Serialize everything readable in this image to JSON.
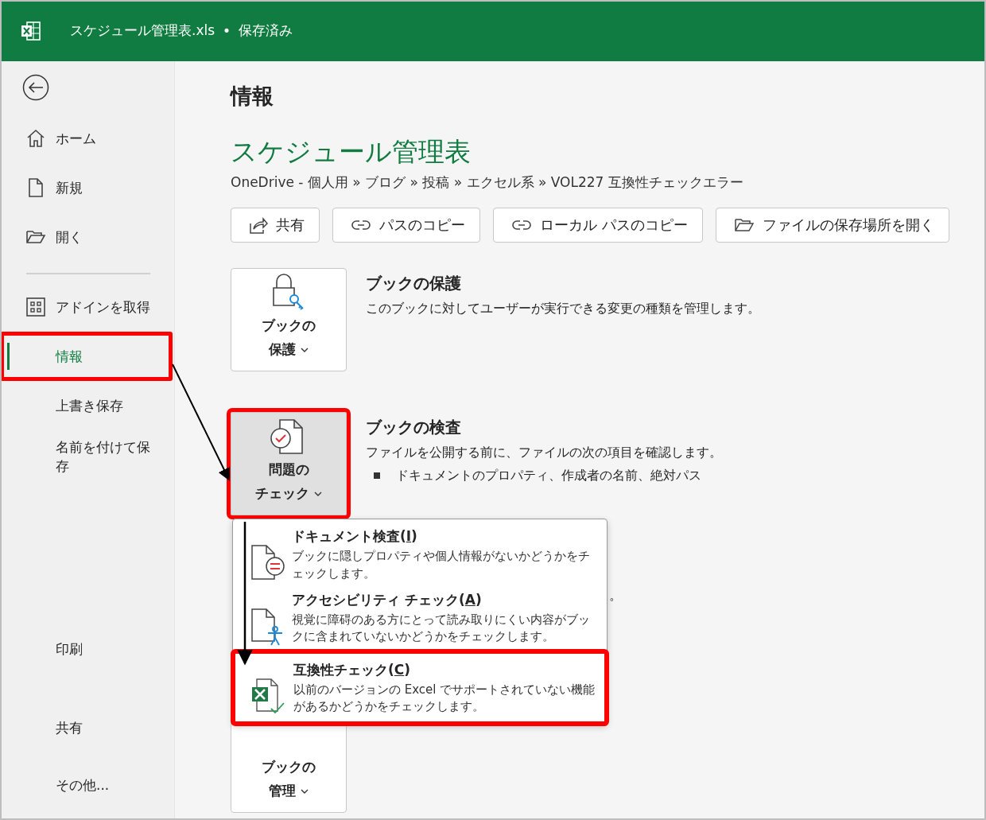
{
  "title_bar": {
    "file_name": "スケジュール管理表.xls",
    "separator": "•",
    "save_status": "保存済み"
  },
  "sidebar": {
    "top_items": [
      {
        "label": "ホーム",
        "kind": "home"
      },
      {
        "label": "新規",
        "kind": "new"
      },
      {
        "label": "開く",
        "kind": "open"
      }
    ],
    "items": [
      {
        "label": "アドインを取得",
        "kind": "addin",
        "selected": false,
        "highlighted": false
      },
      {
        "label": "情報",
        "kind": "plain",
        "selected": true,
        "highlighted": true
      },
      {
        "label": "上書き保存",
        "kind": "plain",
        "selected": false,
        "highlighted": false
      },
      {
        "label": "名前を付けて保存",
        "kind": "plain",
        "selected": false,
        "highlighted": false
      }
    ],
    "bottom_items": [
      {
        "label": "印刷"
      },
      {
        "label": "共有"
      },
      {
        "label": "その他..."
      }
    ]
  },
  "page": {
    "heading": "情報",
    "doc_title": "スケジュール管理表",
    "breadcrumb": "OneDrive - 個人用 » ブログ » 投稿 » エクセル系 » VOL227 互換性チェックエラー",
    "actions": [
      {
        "label": "共有",
        "kind": "share"
      },
      {
        "label": "パスのコピー",
        "kind": "link"
      },
      {
        "label": "ローカル パスのコピー",
        "kind": "link"
      },
      {
        "label": "ファイルの保存場所を開く",
        "kind": "folder"
      }
    ],
    "sections": [
      {
        "kind": "protect",
        "button": {
          "line1": "ブックの",
          "line2": "保護",
          "expanded": false,
          "highlighted": false
        },
        "heading": "ブックの保護",
        "description": "このブックに対してユーザーが実行できる変更の種類を管理します。"
      },
      {
        "kind": "inspect",
        "button": {
          "line1": "問題の",
          "line2": "チェック",
          "expanded": true,
          "highlighted": true
        },
        "heading": "ブックの検査",
        "description": "ファイルを公開する前に、ファイルの次の項目を確認します。",
        "bullets": [
          "ドキュメントのプロパティ、作成者の名前、絶対パス"
        ],
        "hidden_text_tail": "。"
      },
      {
        "kind": "manage",
        "button": {
          "line1": "ブックの",
          "line2": "管理",
          "expanded": false,
          "highlighted": false
        }
      }
    ]
  },
  "dropdown_menu": {
    "items": [
      {
        "kind": "inspect",
        "label": "ドキュメント検査(",
        "accelerator": "I",
        "label_end": ")",
        "description": "ブックに隠しプロパティや個人情報がないかどうかをチェックします。",
        "highlighted": false
      },
      {
        "kind": "accessibility",
        "label": "アクセシビリティ チェック(",
        "accelerator": "A",
        "label_end": ")",
        "description": "視覚に障碍のある方にとって読み取りにくい内容がブックに含まれていないかどうかをチェックします。",
        "highlighted": false
      },
      {
        "kind": "compat",
        "label": "互換性チェック(",
        "accelerator": "C",
        "label_end": ")",
        "description": "以前のバージョンの Excel でサポートされていない機能があるかどうかをチェックします。",
        "highlighted": true
      }
    ]
  }
}
